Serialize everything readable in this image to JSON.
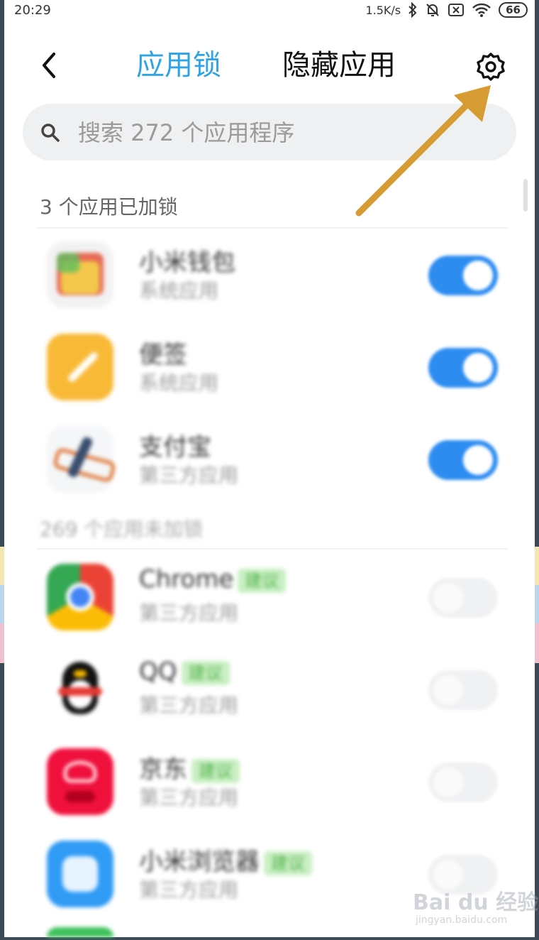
{
  "status_bar": {
    "time": "20:29",
    "net_speed": "1.5K/s",
    "battery": "66"
  },
  "header": {
    "tab_applock": "应用锁",
    "tab_hidden": "隐藏应用",
    "accent_color": "#2ea3e6"
  },
  "search": {
    "placeholder": "搜索 272 个应用程序"
  },
  "locked_section": {
    "label": "3 个应用已加锁",
    "apps": [
      {
        "name": "小米钱包",
        "type": "系统应用",
        "locked": true
      },
      {
        "name": "便签",
        "type": "系统应用",
        "locked": true
      },
      {
        "name": "支付宝",
        "type": "第三方应用",
        "locked": true
      }
    ]
  },
  "unlocked_section": {
    "label": "269 个应用未加锁",
    "apps": [
      {
        "name": "Chrome",
        "badge": "建议",
        "type": "第三方应用",
        "locked": false
      },
      {
        "name": "QQ",
        "badge": "建议",
        "type": "第三方应用",
        "locked": false
      },
      {
        "name": "京东",
        "badge": "建议",
        "type": "第三方应用",
        "locked": false
      },
      {
        "name": "小米浏览器",
        "badge": "建议",
        "type": "第三方应用",
        "locked": false
      }
    ]
  },
  "annotation": {
    "arrow_color": "#d79b33"
  },
  "watermark": {
    "logo": "Bai du 经验",
    "url": "jingyan.baidu.com"
  }
}
